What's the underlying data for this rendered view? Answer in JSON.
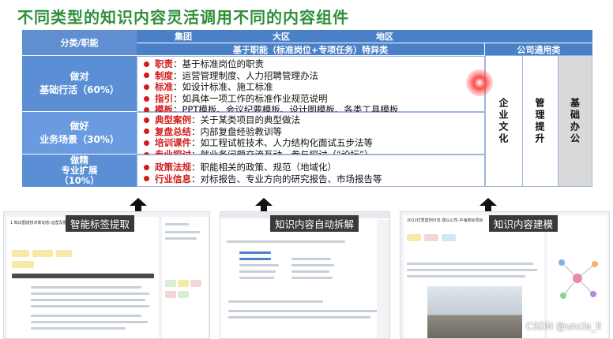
{
  "title": "不同类型的知识内容灵活调用不同的内容组件",
  "table": {
    "corner_header": "分类/职能",
    "top_header": {
      "group": "集团",
      "region": "大区",
      "area": "地区"
    },
    "sub_header_left": "基于职能（标准岗位+专项任务）特异类",
    "sub_header_right": "公司通用类",
    "rows": [
      {
        "category_line1": "做对",
        "category_line2": "基础行活（60%）",
        "category_line3": "",
        "items": [
          {
            "key": "职责",
            "value": "：基于标准岗位的职责"
          },
          {
            "key": "制度",
            "value": "：运营管理制度、人力招聘管理办法"
          },
          {
            "key": "标准",
            "value": "：如设计标准、施工标准"
          },
          {
            "key": "指引",
            "value": "：如具体一项工作的标准作业规范说明"
          },
          {
            "key": "模板",
            "value": "：PPT模板、会议纪要模板、设计图模板、各类工具模板"
          }
        ]
      },
      {
        "category_line1": "做好",
        "category_line2": "业务场景（30%）",
        "category_line3": "",
        "items": [
          {
            "key": "典型案例",
            "value": "：关于某类项目的典型做法"
          },
          {
            "key": "复盘总结",
            "value": "：内部复盘经验教训等"
          },
          {
            "key": "培训课件",
            "value": "：如工程试桩技术、人力结构化面试五步法等"
          },
          {
            "key": "专业探讨",
            "value": "：就业务问题交流互动，参与探讨（“论坛”）"
          }
        ]
      },
      {
        "category_line1": "做精",
        "category_line2": "专业扩展",
        "category_line3": "（10%）",
        "items": [
          {
            "key": "政策法规",
            "value": "：职能相关的政策、规范（地域化）"
          },
          {
            "key": "行业信息",
            "value": "：对标报告、专业方向的研究报告、市场报告等"
          }
        ]
      }
    ],
    "general_columns": [
      "企业文化",
      "管理提升",
      "基础办公"
    ]
  },
  "components": [
    {
      "label": "智能标签提取",
      "doc_title": "1 知识图谱技术新动态-运营及服务市场发展2021"
    },
    {
      "label": "知识内容自动拆解",
      "doc_title": ""
    },
    {
      "label": "知识内容建模",
      "doc_title": "2022优秀案例分享-唐山公司-中海地标项目"
    }
  ],
  "watermark": "CSDN @uncle_ll",
  "colors": {
    "title_green": "#2f8f3a",
    "header_blue": "#4a80c8",
    "category_blue": "#5a8fd6",
    "keyword_red": "#d31b1b",
    "gray_header": "#b0b0b0"
  }
}
